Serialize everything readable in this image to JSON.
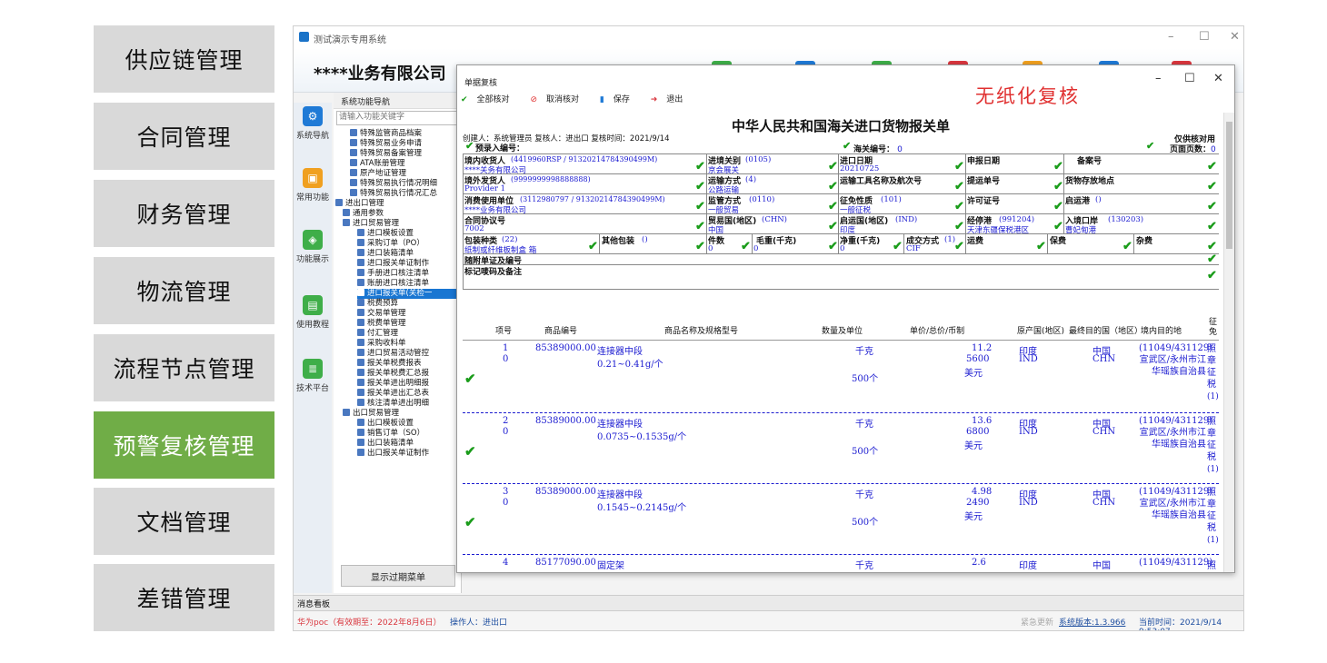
{
  "left_menu": [
    {
      "label": "供应链管理",
      "active": false
    },
    {
      "label": "合同管理",
      "active": false
    },
    {
      "label": "财务管理",
      "active": false
    },
    {
      "label": "物流管理",
      "active": false
    },
    {
      "label": "流程节点管理",
      "active": false
    },
    {
      "label": "预警复核管理",
      "active": true
    },
    {
      "label": "文档管理",
      "active": false
    },
    {
      "label": "差错管理",
      "active": false
    }
  ],
  "app": {
    "title": "测试演示专用系统",
    "company": "****业务有限公司",
    "sidebar_buttons": [
      "系统导航",
      "常用功能",
      "功能展示",
      "使用教程",
      "技术平台"
    ],
    "nav_title": "系统功能导航",
    "search_placeholder": "请输入功能关键字",
    "tree": [
      {
        "label": "特殊监管商品档案"
      },
      {
        "label": "特殊贸易业务申请"
      },
      {
        "label": "特殊贸易备案管理"
      },
      {
        "label": "ATA账册管理"
      },
      {
        "label": "原产地证管理"
      },
      {
        "label": "特殊贸易执行情况明细"
      },
      {
        "label": "特殊贸易执行情况汇总"
      },
      {
        "label": "进出口管理"
      },
      {
        "label": "通用参数"
      },
      {
        "label": "进口贸易管理"
      },
      {
        "label": "进口模板设置"
      },
      {
        "label": "采购订单（PO）"
      },
      {
        "label": "进口装箱清单"
      },
      {
        "label": "进口报关单证制作"
      },
      {
        "label": "手册进口核注清单"
      },
      {
        "label": "账册进口核注清单"
      },
      {
        "label": "进口报关单(关检一"
      },
      {
        "label": "税费预算"
      },
      {
        "label": "交易单管理"
      },
      {
        "label": "税费单管理"
      },
      {
        "label": "付汇管理"
      },
      {
        "label": "采购收料单"
      },
      {
        "label": "进口贸易活动管控"
      },
      {
        "label": "报关单税费报表"
      },
      {
        "label": "报关单税费汇总报"
      },
      {
        "label": "报关单进出明细报"
      },
      {
        "label": "报关单进出汇总表"
      },
      {
        "label": "核注清单进出明细"
      },
      {
        "label": "出口贸易管理"
      },
      {
        "label": "出口模板设置"
      },
      {
        "label": "销售订单（SO）"
      },
      {
        "label": "出口装箱清单"
      },
      {
        "label": "出口报关单证制作"
      }
    ],
    "show_expired_button": "显示过期菜单",
    "message_board": "消息看板",
    "license": "华为poc（有效期至：2022年8月6日）",
    "operator": "操作人：进出口",
    "emergency_update": "紧急更新",
    "version": "系统版本:1.3.966",
    "current_time": "当前时间：2021/9/14 9:53:07"
  },
  "dialog": {
    "title": "单据复核",
    "toolbar": {
      "all_check": "全部核对",
      "cancel_check": "取消核对",
      "save": "保存",
      "exit": "退出"
    },
    "paperless_label": "无纸化复核",
    "doc_title": "中华人民共和国海关进口货物报关单",
    "creator_line": "创建人：系统管理员  复核人：进出口  复核时间：2021/9/14",
    "verify_only": "仅供核对用",
    "page_count_label": "页面页数：",
    "page_count_value": "0",
    "preentry_label": "预录入编号：",
    "customs_no_label": "海关编号：",
    "customs_no_value": "0",
    "fields": {
      "consignee_label": "境内收货人",
      "consignee_code": "(4419960RSP / 91320214784390499M)",
      "consignee_name": "****关务有限公司",
      "entry_customs_label": "进境关别",
      "entry_customs_code": "(0105)",
      "entry_customs_name": "京会展关",
      "import_date_label": "进口日期",
      "import_date_value": "20210725",
      "declare_date_label": "申报日期",
      "record_no_label": "备案号",
      "shipper_label": "境外发货人",
      "shipper_code": "(9999999998888888)",
      "shipper_name": "Provider 1",
      "transport_mode_label": "运输方式",
      "transport_mode_code": "(4)",
      "transport_mode_name": "公路运输",
      "transport_tool_label": "运输工具名称及航次号",
      "bill_no_label": "提运单号",
      "storage_label": "货物存放地点",
      "consumer_label": "消费使用单位",
      "consumer_code": "(3112980797 / 91320214784390499M)",
      "consumer_name": "****业务有限公司",
      "supervision_label": "监管方式",
      "supervision_code": "(0110)",
      "supervision_name": "一般贸易",
      "tax_nature_label": "征免性质",
      "tax_nature_code": "(101)",
      "tax_nature_name": "一般征税",
      "license_no_label": "许可证号",
      "departure_port_label": "启运港",
      "departure_port_code": "()",
      "contract_no_label": "合同协议号",
      "contract_no_value": "7002",
      "trade_country_label": "贸易国(地区)",
      "trade_country_code": "(CHN)",
      "trade_country_name": "中国",
      "origin_country_label": "启运国(地区)",
      "origin_country_code": "(IND)",
      "origin_country_name": "印度",
      "via_port_label": "经停港",
      "via_port_code": "(991204)",
      "via_port_name": "天津东疆保税港区",
      "entry_port_label": "入境口岸",
      "entry_port_code": "(130203)",
      "entry_port_name": "曹妃甸港",
      "package_label": "包装种类",
      "package_code": "(22)",
      "package_name": "纸制或纤维板制盒 箱",
      "other_package_label": "其他包装",
      "other_package_code": "()",
      "pieces_label": "件数",
      "pieces_value": "0",
      "gross_weight_label": "毛重(千克)",
      "gross_weight_value": "0",
      "net_weight_label": "净重(千克)",
      "net_weight_value": "0",
      "deal_mode_label": "成交方式",
      "deal_mode_code": "(1)",
      "deal_mode_name": "CIF",
      "freight_label": "运费",
      "insurance_label": "保费",
      "misc_label": "杂费",
      "attached_docs_label": "随附单证及编号",
      "marks_label": "标记唛码及备注"
    },
    "goods_headers": [
      "项号",
      "商品编号",
      "商品名称及规格型号",
      "数量及单位",
      "单价/总价/币制",
      "原产国(地区)",
      "最终目的国（地区）",
      "境内目的地",
      "征免"
    ],
    "goods": [
      {
        "item": "1",
        "sub": "0",
        "code": "85389000.00",
        "name": "连接器中段",
        "spec": "0.21~0.41g/个",
        "unit": "千克",
        "qty": "500个",
        "price": "11.2",
        "total": "5600",
        "currency": "美元",
        "origin": "印度",
        "origin_code": "IND",
        "dest": "中国",
        "dest_code": "CHN",
        "domestic": "(11049/431129)",
        "domestic_name": "宣武区/永州市江华瑶族自治县",
        "levy": "照章征税",
        "levy_code": "(1)"
      },
      {
        "item": "2",
        "sub": "0",
        "code": "85389000.00",
        "name": "连接器中段",
        "spec": "0.0735~0.1535g/个",
        "unit": "千克",
        "qty": "500个",
        "price": "13.6",
        "total": "6800",
        "currency": "美元",
        "origin": "印度",
        "origin_code": "IND",
        "dest": "中国",
        "dest_code": "CHN",
        "domestic": "(11049/431129)",
        "domestic_name": "宣武区/永州市江华瑶族自治县",
        "levy": "照章征税",
        "levy_code": "(1)"
      },
      {
        "item": "3",
        "sub": "0",
        "code": "85389000.00",
        "name": "连接器中段",
        "spec": "0.1545~0.2145g/个",
        "unit": "千克",
        "qty": "500个",
        "price": "4.98",
        "total": "2490",
        "currency": "美元",
        "origin": "印度",
        "origin_code": "IND",
        "dest": "中国",
        "dest_code": "CHN",
        "domestic": "(11049/431129)",
        "domestic_name": "宣武区/永州市江华瑶族自治县",
        "levy": "照章征税",
        "levy_code": "(1)"
      },
      {
        "item": "4",
        "sub": "0",
        "code": "85177090.00",
        "name": "固定架",
        "spec": "",
        "unit": "千克",
        "qty": "",
        "price": "2.6",
        "total": "",
        "currency": "",
        "origin": "印度",
        "origin_code": "",
        "dest": "中国",
        "dest_code": "",
        "domestic": "(11049/431129)",
        "domestic_name": "",
        "levy": "照",
        "levy_code": ""
      }
    ],
    "colors": {
      "check": "#1a9c1a",
      "value_blue": "#1a1ad0",
      "accent_red": "#e03030"
    }
  }
}
